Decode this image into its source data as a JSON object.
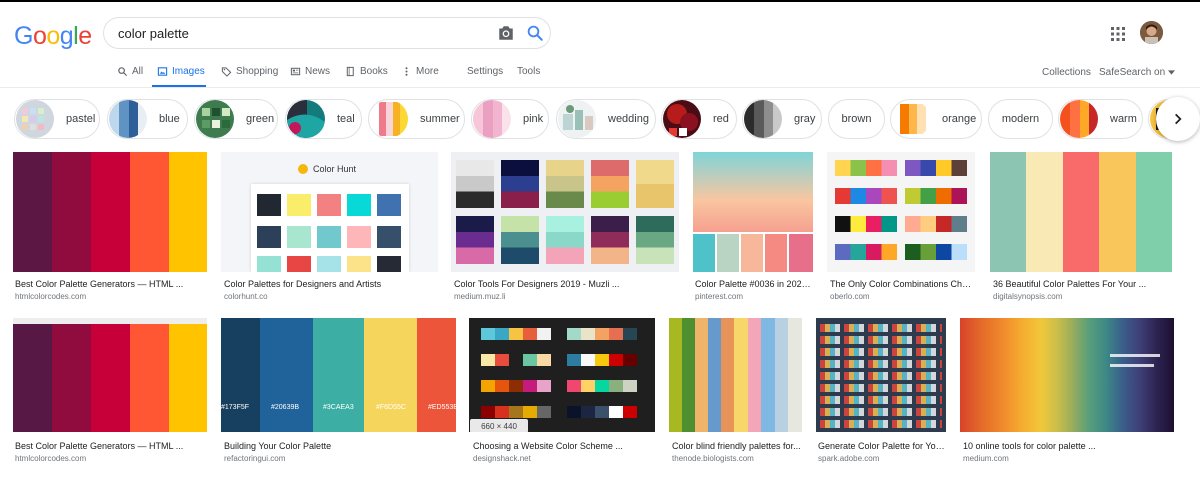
{
  "logo": {
    "letters": [
      "G",
      "o",
      "o",
      "g",
      "l",
      "e"
    ],
    "colors": [
      "#4285f4",
      "#ea4335",
      "#fbbc05",
      "#4285f4",
      "#34a853",
      "#ea4335"
    ]
  },
  "search": {
    "value": "color palette",
    "placeholder": ""
  },
  "nav": {
    "all": "All",
    "images": "Images",
    "shopping": "Shopping",
    "news": "News",
    "books": "Books",
    "more": "More",
    "settings": "Settings",
    "tools": "Tools",
    "collections": "Collections",
    "safesearch": "SafeSearch on"
  },
  "chips": [
    "pastel",
    "blue",
    "green",
    "teal",
    "summer",
    "pink",
    "wedding",
    "red",
    "gray",
    "brown",
    "orange",
    "modern",
    "warm"
  ],
  "results": [
    {
      "title": "Best Color Palette Generators — HTML ...",
      "source": "htmlcolorcodes.com"
    },
    {
      "title": "Color Palettes for Designers and Artists",
      "source": "colorhunt.co"
    },
    {
      "title": "Color Tools For Designers 2019 - Muzli ...",
      "source": "medium.muz.li"
    },
    {
      "title": "Color Palette #0036 in 2020...",
      "source": "pinterest.com"
    },
    {
      "title": "The Only Color Combinations Chea...",
      "source": "oberlo.com"
    },
    {
      "title": "36 Beautiful Color Palettes For Your ...",
      "source": "digitalsynopsis.com"
    },
    {
      "title": "Best Color Palette Generators — HTML ...",
      "source": "htmlcolorcodes.com"
    },
    {
      "title": "Building Your Color Palette",
      "source": "refactoringui.com"
    },
    {
      "title": "Choosing a Website Color Scheme ...",
      "source": "designshack.net"
    },
    {
      "title": "Color blind friendly palettes for...",
      "source": "thenode.biologists.com"
    },
    {
      "title": "Generate Color Palette for You...",
      "source": "spark.adobe.com"
    },
    {
      "title": "10 online tools for color palette ...",
      "source": "medium.com"
    }
  ],
  "image_text": {
    "colorhunt": "Color Hunt",
    "refactoring_hex": [
      "#173F5F",
      "#20639B",
      "#3CAEA3",
      "#F6D55C",
      "#ED553B"
    ],
    "dimensions": "660 × 440"
  },
  "colors": {
    "accent": "#1a73e8"
  }
}
